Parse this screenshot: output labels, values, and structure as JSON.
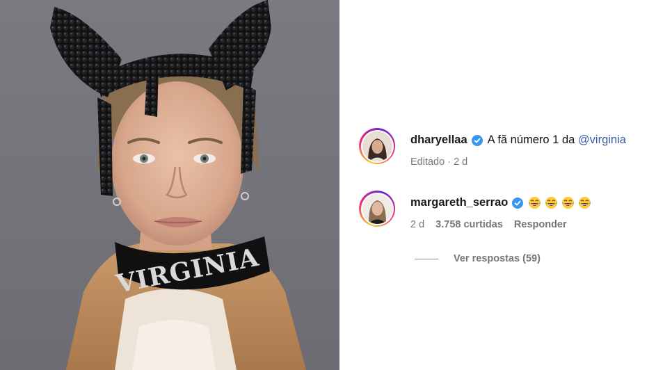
{
  "photo": {
    "collar_text": "VIRGINIA"
  },
  "comments": [
    {
      "username": "dharyellaa",
      "verified": true,
      "text_prefix": "A fã número 1 da",
      "mention": "@virginia",
      "meta": {
        "edited": "Editado · 2 d"
      }
    },
    {
      "username": "margareth_serrao",
      "verified": true,
      "emoji_icon": "laughing-tears-emoji",
      "emoji_count": 4,
      "meta": {
        "time": "2 d",
        "likes": "3.758 curtidas",
        "reply": "Responder"
      }
    }
  ],
  "view_replies": "Ver respostas (59)",
  "colors": {
    "verified_badge": "#3897f0",
    "mention": "#3a5ba8",
    "meta_text": "#777777"
  }
}
